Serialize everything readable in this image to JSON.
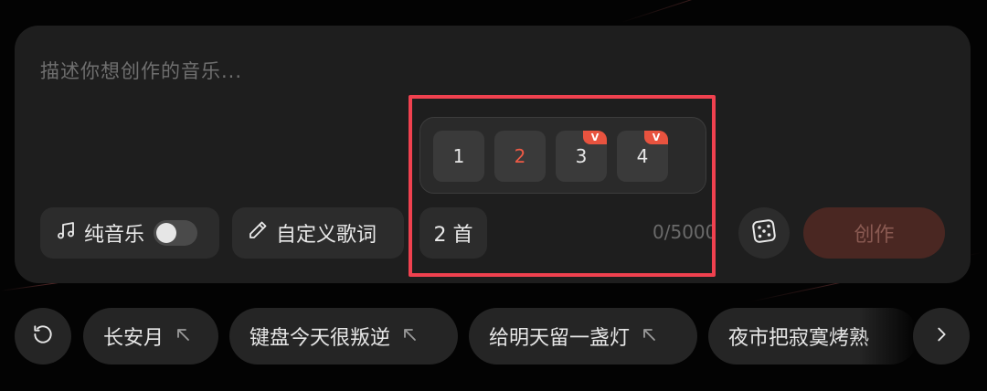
{
  "composer": {
    "placeholder": "描述你想创作的音乐...",
    "pure_music_label": "纯音乐",
    "pure_music_on": false,
    "custom_lyrics_label": "自定义歌词",
    "song_count_label": "2 首",
    "char_counter": "0/5000",
    "create_label": "创作"
  },
  "count_picker": {
    "options": [
      {
        "label": "1",
        "selected": false,
        "badge": ""
      },
      {
        "label": "2",
        "selected": true,
        "badge": ""
      },
      {
        "label": "3",
        "selected": false,
        "badge": "V"
      },
      {
        "label": "4",
        "selected": false,
        "badge": "V"
      }
    ]
  },
  "suggestions": {
    "items": [
      "长安月",
      "键盘今天很叛逆",
      "给明天留一盏灯",
      "夜市把寂寞烤熟"
    ]
  },
  "colors": {
    "accent": "#ef5a45",
    "highlight_box": "#f0414f",
    "badge": "#e8533f"
  },
  "icons": [
    "music-note-icon",
    "pencil-icon",
    "dice-icon",
    "refresh-icon",
    "arrow-up-left-icon",
    "chevron-right-icon"
  ]
}
